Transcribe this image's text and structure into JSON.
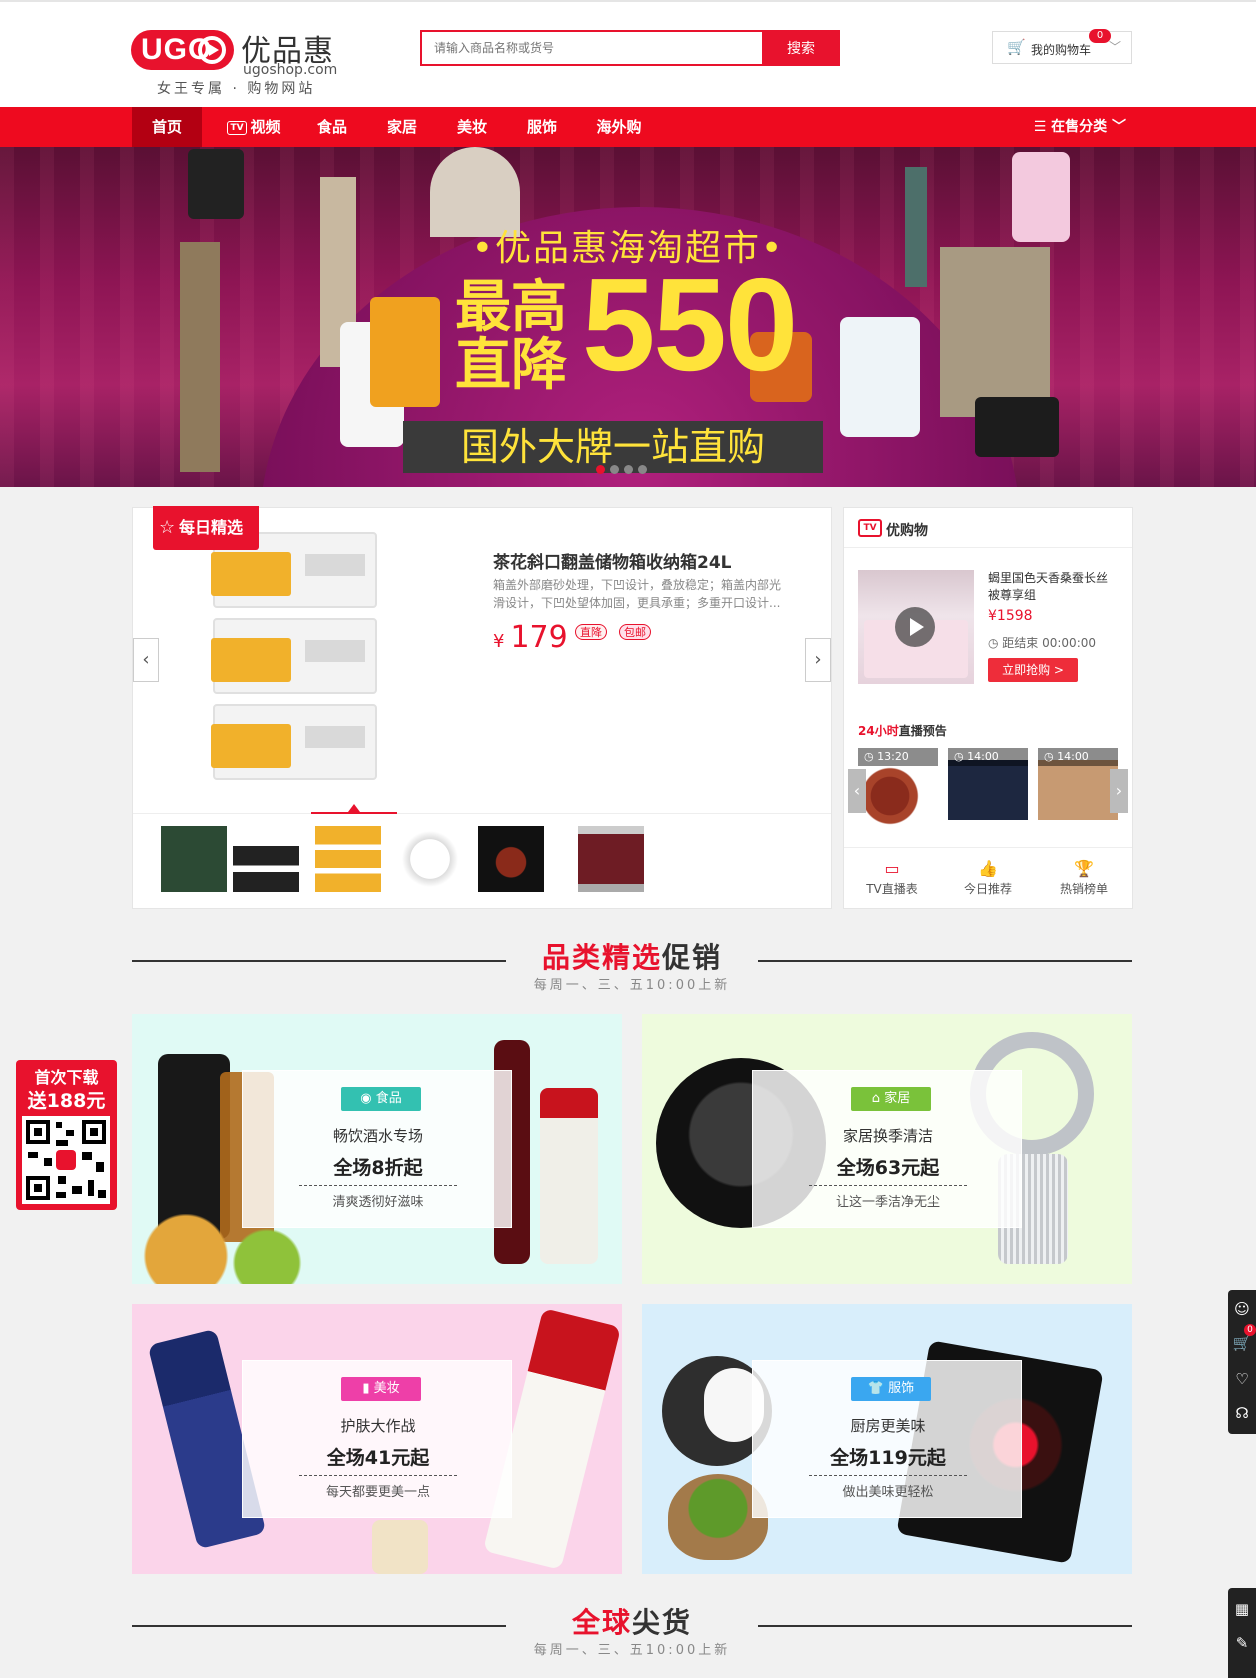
{
  "header": {
    "logo_mark": "UGO",
    "logo_name": "优品惠",
    "logo_url": "ugoshop.com",
    "slogan": "女王专属 · 购物网站",
    "search_placeholder": "请输入商品名称或货号",
    "search_button": "搜索",
    "cart_label": "我的购物车",
    "cart_count": "0"
  },
  "nav": {
    "items": [
      "首页",
      "视频",
      "食品",
      "家居",
      "美妆",
      "服饰",
      "海外购"
    ],
    "tv_badge": "TV",
    "category_label": "在售分类",
    "active_index": 0,
    "accent": "#ee0a1f",
    "active_bg": "#b30012"
  },
  "banner": {
    "headline": "•优品惠海淘超市•",
    "big_left_1": "最高",
    "big_left_2": "直降",
    "big_number": "550",
    "strip": "国外大牌一站直购",
    "slide_count": 4,
    "active_slide": 0
  },
  "daily": {
    "ribbon": "每日精选",
    "title": "茶花斜口翻盖储物箱收纳箱24L",
    "desc": "箱盖外部磨砂处理，下凹设计，叠放稳定；箱盖内部光滑设计，下凹处望体加固，更具承重；多重开口设计...",
    "currency": "¥",
    "price": "179",
    "tag_drop": "直降",
    "tag_ship": "包邮",
    "thumbs": [
      "rice-bag",
      "gift-boxes",
      "storage-boxes",
      "kettle",
      "tea-set",
      "coat-model"
    ],
    "active_thumb": 2
  },
  "tvshop": {
    "title": "优购物",
    "tv_icon": "TV",
    "live_title": "蝎里国色天香桑蚕长丝被尊享组",
    "live_price": "¥1598",
    "timer": "距结束 00:00:00",
    "buy_button": "立即抢购 >",
    "preview_hl": "24小时",
    "preview_rest": "直播预告",
    "previews": [
      {
        "time": "13:20",
        "item": "red-dates"
      },
      {
        "time": "14:00",
        "item": "navy-sweater"
      },
      {
        "time": "14:00",
        "item": "camel-sweater"
      }
    ],
    "footer": [
      "TV直播表",
      "今日推荐",
      "热销榜单"
    ]
  },
  "section1": {
    "title_hl": "品类精选",
    "title_rest": "促销",
    "subtitle": "每周一、三、五10:00上新"
  },
  "promos": [
    {
      "badge": "食品",
      "badge_color": "#33c1b1",
      "title": "畅饮酒水专场",
      "price": "全场8折起",
      "sub": "清爽透彻好滋味",
      "bg": "#e0faf5"
    },
    {
      "badge": "家居",
      "badge_color": "#7ac23a",
      "title": "家居换季清洁",
      "price": "全场63元起",
      "sub": "让这一季洁净无尘",
      "bg": "#eefbdd"
    },
    {
      "badge": "美妆",
      "badge_color": "#ee3fa8",
      "title": "护肤大作战",
      "price": "全场41元起",
      "sub": "每天都要更美一点",
      "bg": "#fbd4ea"
    },
    {
      "badge": "服饰",
      "badge_color": "#3aa7f0",
      "title": "厨房更美味",
      "price": "全场119元起",
      "sub": "做出美味更轻松",
      "bg": "#d8eefb"
    }
  ],
  "section2": {
    "title_hl": "全球",
    "title_rest": "尖货",
    "subtitle": "每周一、三、五10:00上新"
  },
  "floating": {
    "line1": "首次下载",
    "line2": "送188元"
  },
  "sidebar": {
    "cart_count": "0"
  }
}
